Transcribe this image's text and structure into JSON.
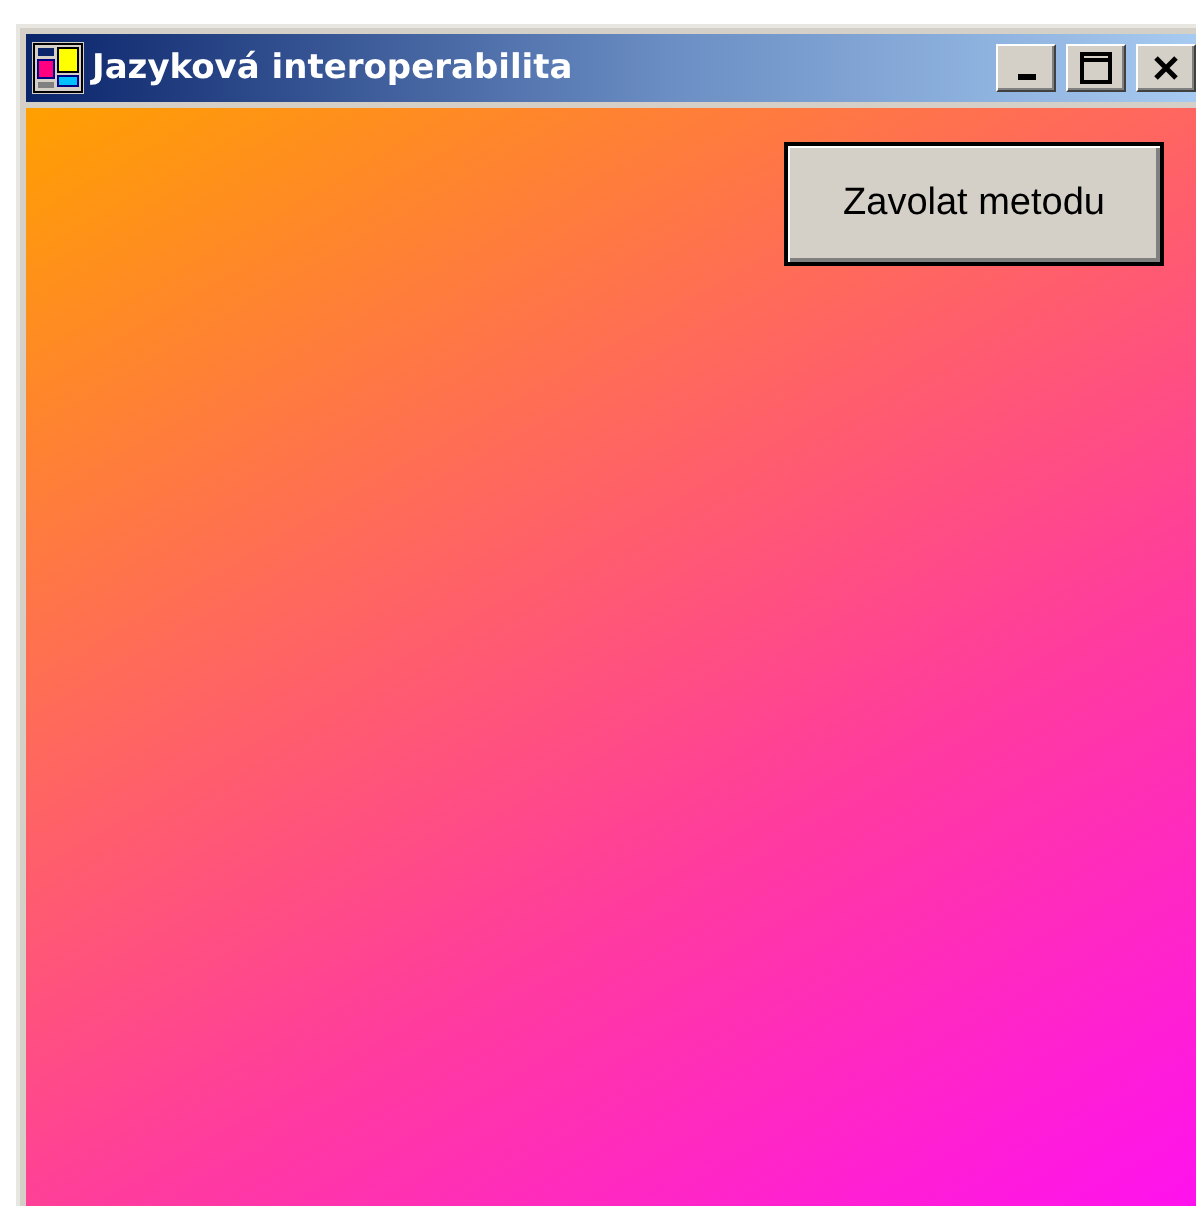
{
  "window": {
    "title": "Jazyková interoperabilita"
  },
  "title_buttons": [
    {
      "kind": "minimize"
    },
    {
      "kind": "maximize"
    },
    {
      "kind": "close"
    }
  ],
  "button": {
    "label": "Zavolat metodu"
  }
}
